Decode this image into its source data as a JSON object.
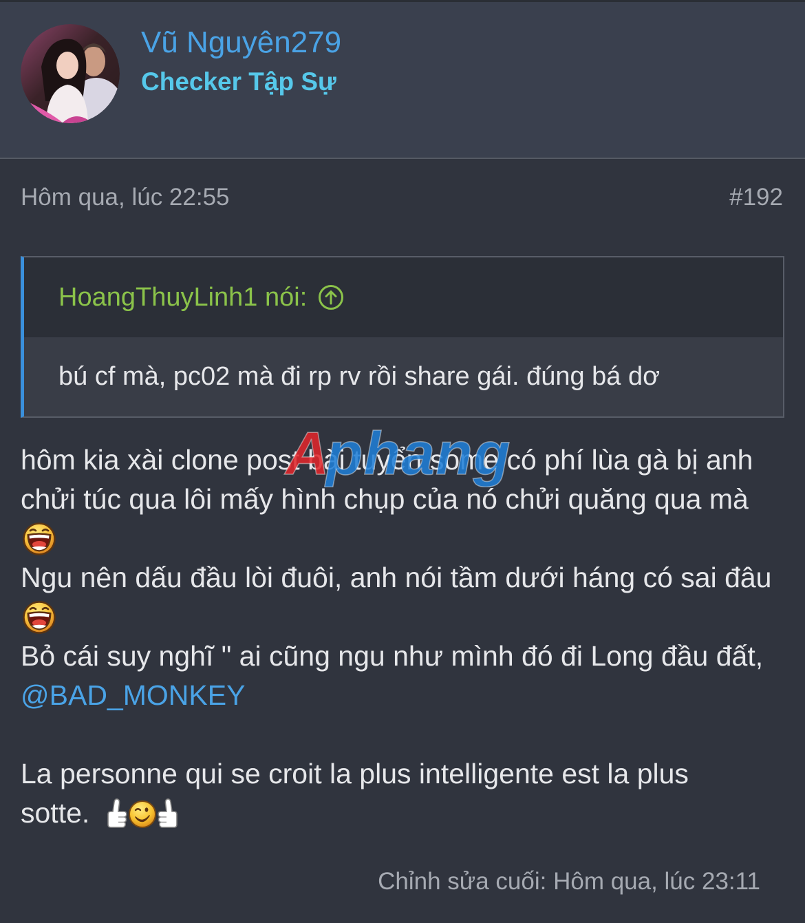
{
  "colors": {
    "background": "#30343e",
    "header_background": "#3a404e",
    "separator": "#555a64",
    "text": "#e6e7ea",
    "muted": "#a6aab2",
    "username": "#4aa3e6",
    "user_title": "#56c8ea",
    "quote_author": "#8bc34a",
    "quote_accent": "#3a90dc",
    "quote_border": "#585d68",
    "quote_header_background": "#2b2f37",
    "quote_body_background": "#393d47",
    "mention": "#4aa3e6",
    "watermark_red": "#e3262b",
    "watermark_blue": "#1f7fd8"
  },
  "icons": {
    "quote_jump": "arrow-up-circle",
    "laugh_emoji": "laughing-face",
    "thumbs_emoji": "double-thumbs-up-wink"
  },
  "post": {
    "author": {
      "username": "Vũ Nguyên279",
      "title": "Checker Tập Sự"
    },
    "meta": {
      "date": "Hôm qua, lúc 22:55",
      "post_number": "#192"
    },
    "quote": {
      "author_label": "HoangThuyLinh1 nói:",
      "text": "bú cf mà, pc02 mà đi rp rv rồi share gái. đúng bá dơ"
    },
    "body": {
      "lines": [
        "hôm kia xài clone post bài tuyển some có phí lùa gà bị anh",
        "chửi túc qua lôi mấy hình chụp của nó chửi quăng qua mà",
        "Ngu nên dấu đầu lòi đuôi, anh nói tầm dưới háng có sai đâu",
        "Bỏ cái suy nghĩ \" ai cũng ngu như mình đó đi Long đầu đất,"
      ],
      "mention": "@BAD_MONKEY",
      "closing_lines": [
        "La personne qui se croit la plus intelligente est la plus",
        "sotte."
      ]
    },
    "last_edited": "Chỉnh sửa cuối: Hôm qua, lúc 23:11"
  },
  "watermark": {
    "prefix": "A",
    "suffix": "phang"
  }
}
